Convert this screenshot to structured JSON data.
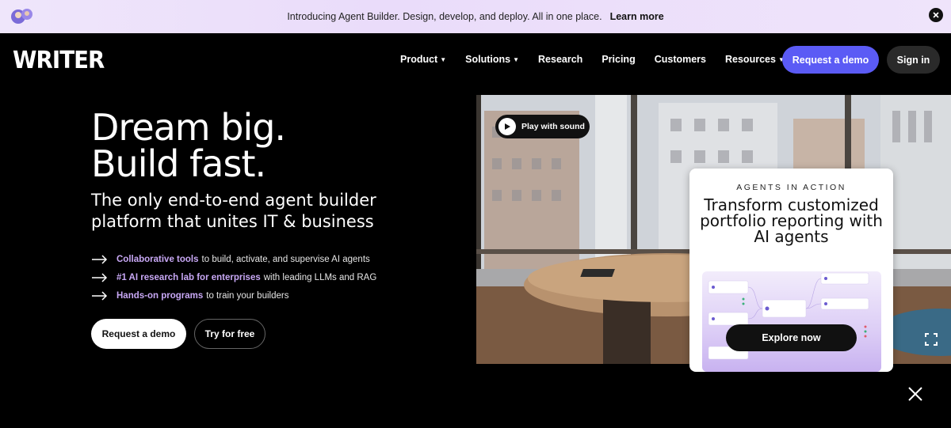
{
  "announcement": {
    "message": "Introducing Agent Builder. Design, develop, and deploy. All in one place.",
    "link": "Learn more"
  },
  "header": {
    "logo": "WRITER",
    "nav": [
      {
        "label": "Product",
        "dropdown": true
      },
      {
        "label": "Solutions",
        "dropdown": true
      },
      {
        "label": "Research",
        "dropdown": false
      },
      {
        "label": "Pricing",
        "dropdown": false
      },
      {
        "label": "Customers",
        "dropdown": false
      },
      {
        "label": "Resources",
        "dropdown": true
      }
    ],
    "demo_button": "Request a demo",
    "signin_button": "Sign in"
  },
  "hero": {
    "title_line1": "Dream big.",
    "title_line2": "Build fast.",
    "subtitle": "The only end-to-end agent builder platform that unites IT & business",
    "bullets": [
      {
        "highlight": "Collaborative tools",
        "rest": "to build, activate, and supervise AI agents"
      },
      {
        "highlight": "#1 AI research lab for enterprises",
        "rest": "with leading LLMs and RAG"
      },
      {
        "highlight": "Hands-on programs",
        "rest": "to train your builders"
      }
    ],
    "cta_primary": "Request a demo",
    "cta_secondary": "Try for free"
  },
  "video": {
    "play_label": "Play with sound"
  },
  "card": {
    "eyebrow": "AGENTS IN ACTION",
    "title": "Transform customized portfolio reporting with AI agents",
    "button": "Explore now"
  },
  "colors": {
    "accent": "#5b5bf5",
    "highlight": "#c8a8f5",
    "announce_bg": "#eadcfa"
  }
}
